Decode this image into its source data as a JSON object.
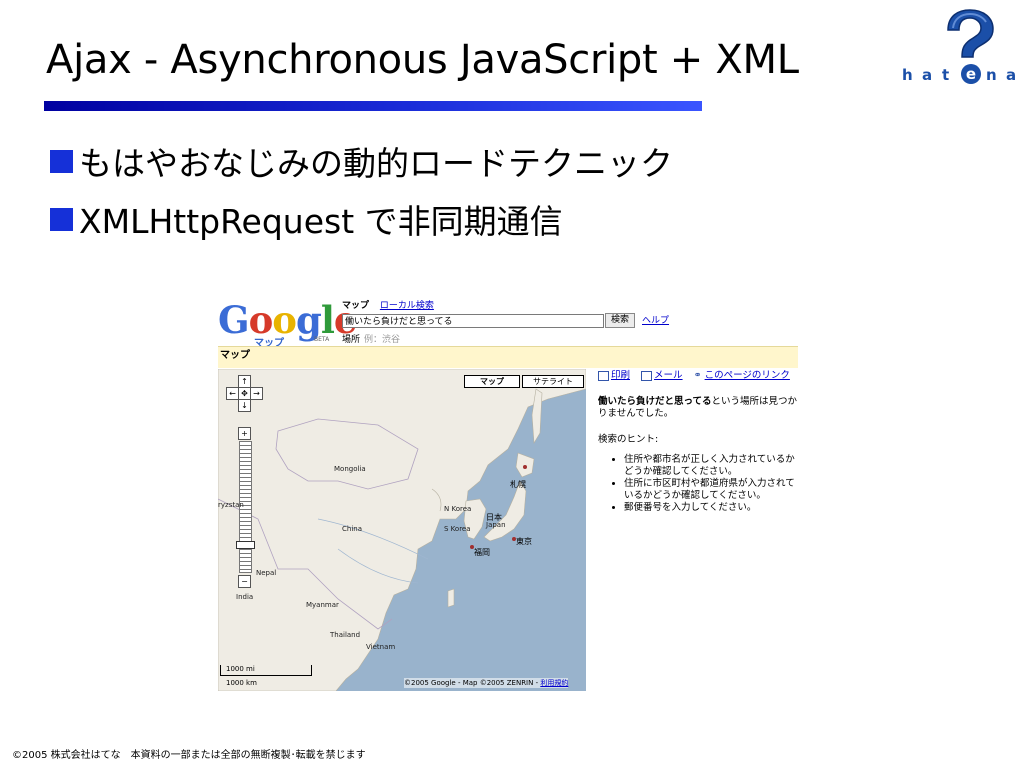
{
  "slide": {
    "title": "Ajax - Asynchronous JavaScript + XML",
    "bullets": [
      "もはやおなじみの動的ロードテクニック",
      "XMLHttpRequest で非同期通信"
    ],
    "footer": "©2005 株式会社はてな　本資料の一部または全部の無断複製･転載を禁じます"
  },
  "logo": {
    "text": "hatena",
    "letters": [
      "h",
      "a",
      "t",
      "e",
      "n",
      "a"
    ],
    "color": "#1b4fa8"
  },
  "gmaps": {
    "logo_text": "Google",
    "logo_sub": "マップ",
    "logo_beta": "BETA",
    "tabs": {
      "current": "マップ",
      "local": "ローカル検索"
    },
    "search_value": "働いたら負けだと思ってる",
    "search_button": "検索",
    "help_link": "ヘルプ",
    "place_label": "場所",
    "place_example": "例：渋谷",
    "bar_label": "マップ",
    "map_type_buttons": [
      "マップ",
      "サテライト"
    ],
    "labels": {
      "mongolia": "Mongolia",
      "china": "China",
      "nkorea": "N Korea",
      "skorea": "S Korea",
      "japan": "Japan",
      "nepal": "Nepal",
      "india": "India",
      "myanmar": "Myanmar",
      "thailand": "Thailand",
      "vietnam": "Vietnam",
      "kyrgyz": "ryzstan"
    },
    "cities": {
      "sapporo": "札幌",
      "nihon": "日本",
      "tokyo": "東京",
      "fukuoka": "福岡"
    },
    "scale": [
      "1000 mi",
      "1000 km"
    ],
    "copyright": "©2005 Google - Map ©2005 ZENRIN -",
    "terms_link": "利用規約",
    "side": {
      "links": [
        "印刷",
        "メール",
        "このページのリンク"
      ],
      "query": "働いたら負けだと思ってる",
      "not_found_rest": "という場所は見つかりませんでした。",
      "hint_title": "検索のヒント:",
      "hints": [
        "住所や都市名が正しく入力されているかどうか確認してください。",
        "住所に市区町村や都道府県が入力されているかどうか確認してください。",
        "郵便番号を入力してください。"
      ]
    }
  }
}
